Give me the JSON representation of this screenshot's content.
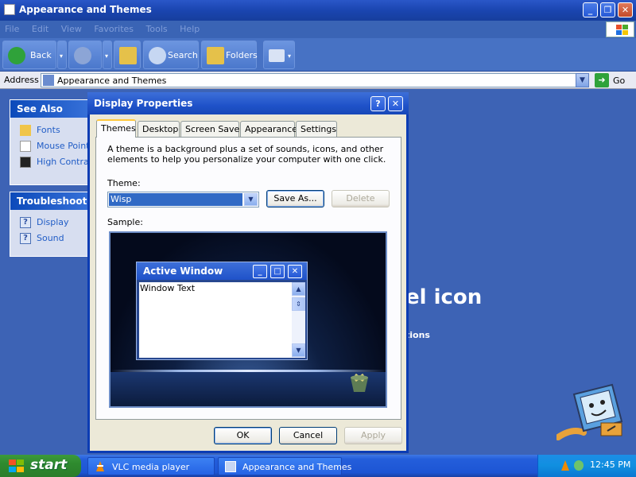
{
  "explorer": {
    "title": "Appearance and Themes",
    "menu": [
      "File",
      "Edit",
      "View",
      "Favorites",
      "Tools",
      "Help"
    ],
    "toolbar": {
      "back": "Back",
      "search": "Search",
      "folders": "Folders"
    },
    "address": {
      "label": "Address",
      "value": "Appearance and Themes",
      "go": "Go"
    },
    "see_also": {
      "header": "See Also",
      "items": [
        "Fonts",
        "Mouse Pointers",
        "High Contrast"
      ]
    },
    "troubleshooters": {
      "header": "Troubleshooters",
      "items": [
        "Display",
        "Sound"
      ]
    },
    "banner_fragment": "el icon",
    "banner_fragment2": "tions"
  },
  "dialog": {
    "title": "Display Properties",
    "help": "?",
    "close": "✕",
    "tabs": [
      "Themes",
      "Desktop",
      "Screen Saver",
      "Appearance",
      "Settings"
    ],
    "active_tab": "Themes",
    "description": "A theme is a background plus a set of sounds, icons, and other elements to help you personalize your computer with one click.",
    "theme_label": "Theme:",
    "theme_value": "Wisp",
    "save_as": "Save As...",
    "delete": "Delete",
    "sample_label": "Sample:",
    "sample": {
      "window_title": "Active Window",
      "window_text": "Window Text"
    },
    "ok": "OK",
    "cancel": "Cancel",
    "apply": "Apply"
  },
  "taskbar": {
    "start": "start",
    "items": [
      "VLC media player",
      "Appearance and Themes"
    ],
    "clock": "12:45 PM"
  },
  "colors": {
    "title_blue": "#1f52c9",
    "start_green": "#2e8a2e",
    "tray_blue": "#108fe0",
    "selection": "#316ac5"
  }
}
